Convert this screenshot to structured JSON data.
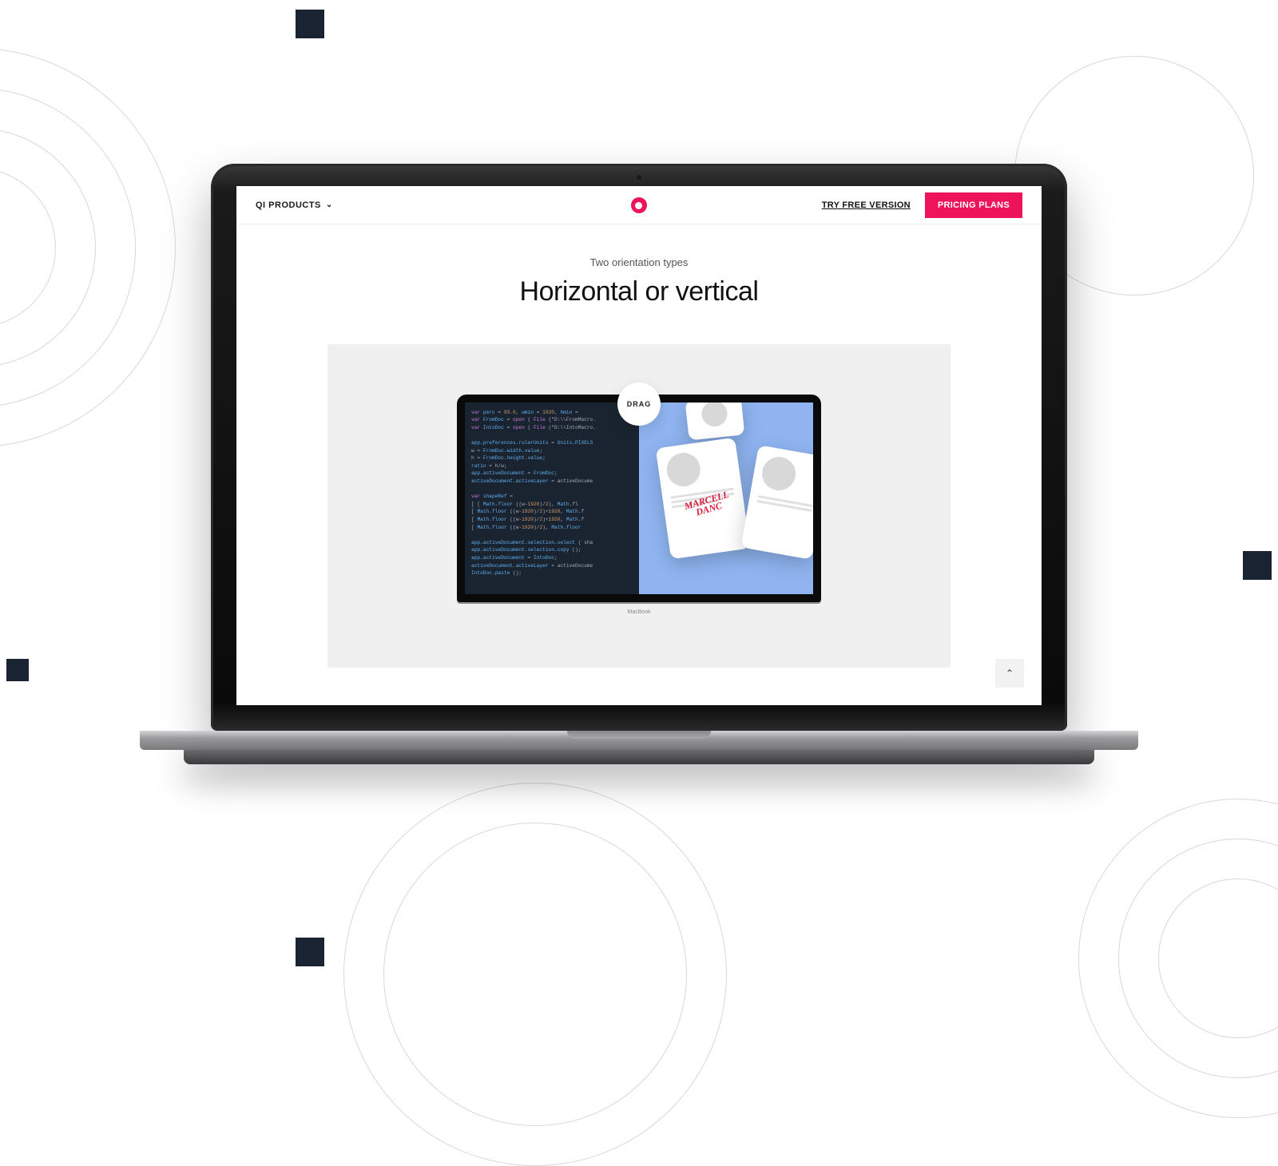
{
  "nav": {
    "products_label": "QI PRODUCTS",
    "try_free_label": "TRY FREE VERSION",
    "pricing_label": "PRICING PLANS"
  },
  "hero": {
    "subtitle": "Two orientation types",
    "title": "Horizontal or vertical"
  },
  "slider": {
    "drag_label": "DRAG",
    "inner_device_label": "MacBook",
    "right_card_text": "MARCELL DANC",
    "code_lines": [
      "var perc = 99.0, wmin = 1920, hmin =",
      "var FromDoc = open ( File (\"D:\\\\FromMacro.",
      "var IntoDoc = open ( File (\"D:\\\\IntoMacro.",
      "",
      "app.preferences.rulerUnits = Units.PIXELS",
      "w = FromDoc.width.value;",
      "h = FromDoc.height.value;",
      "ratio = h/w;",
      "app.activeDocument = FromDoc;",
      "activeDocument.activeLayer = activeDocume",
      "",
      "var shapeRef =",
      "[ [ Math.floor ((w-1920)/2), Math.fl",
      "  [ Math.floor ((w-1920)/2)+1920, Math.f",
      "  [ Math.floor ((w-1920)/2)+1920, Math.f",
      "  [ Math.floor ((w-1920)/2), Math.floor",
      "",
      "app.activeDocument.selection.select ( sha",
      "    app.activeDocument.selection.copy ();",
      "    app.activeDocument = IntoDoc;",
      "activeDocument.activeLayer = activeDocume",
      "IntoDoc.paste ();"
    ]
  },
  "scroll_top_glyph": "⌃"
}
